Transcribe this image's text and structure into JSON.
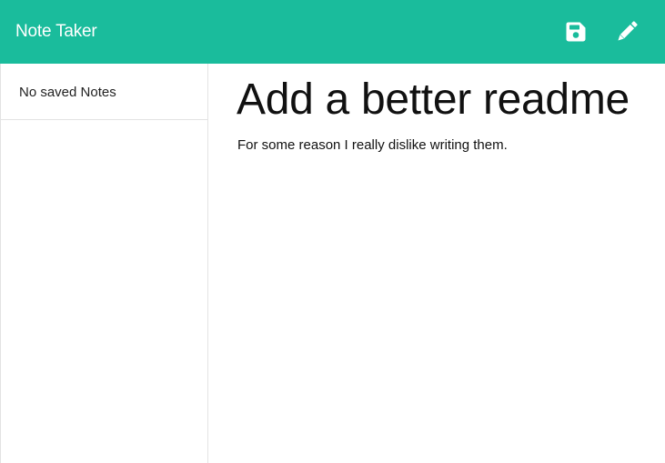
{
  "navbar": {
    "brand": "Note Taker",
    "save_icon": "save-icon",
    "edit_icon": "pencil-icon",
    "icon_color": "#ffffff",
    "background": "#1abc9c"
  },
  "sidebar": {
    "empty_message": "No saved Notes"
  },
  "note": {
    "title": "Add a better readme",
    "text": "For some reason I really dislike writing them."
  }
}
